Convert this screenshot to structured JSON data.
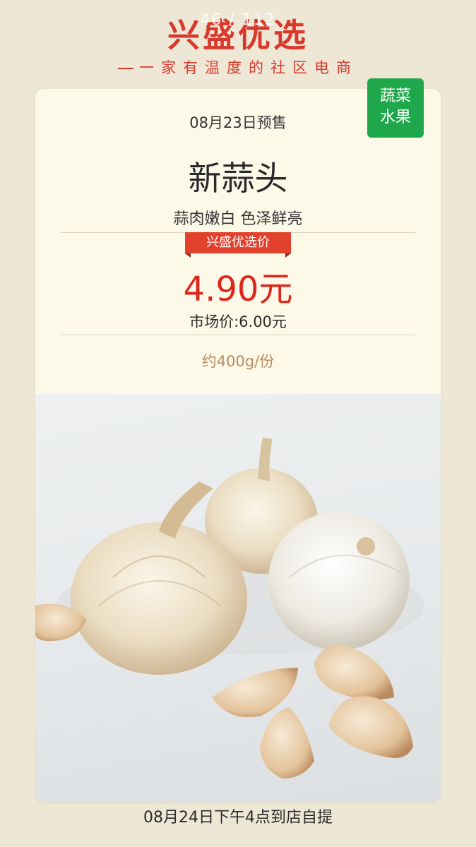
{
  "viewer": {
    "page_counter": "46 / 112"
  },
  "brand": {
    "title": "兴盛优选",
    "slogan": "一家有温度的社区电商"
  },
  "product": {
    "category_tag_line1": "蔬菜",
    "category_tag_line2": "水果",
    "presale_date": "08月23日预售",
    "name": "新蒜头",
    "description": "蒜肉嫩白 色泽鲜亮",
    "price_badge_label": "兴盛优选价",
    "sale_price": "4.90元",
    "market_price": "市场价:6.00元",
    "unit_weight": "约400g/份",
    "photo": "garlic-bulbs-photo"
  },
  "pickup": {
    "info": "08月24日下午4点到店自提"
  },
  "colors": {
    "brand_red": "#d8392b",
    "price_red": "#e0251a",
    "category_green": "#1fa84b",
    "page_background": "#efe7d6",
    "card_background": "#fdf9e9"
  }
}
